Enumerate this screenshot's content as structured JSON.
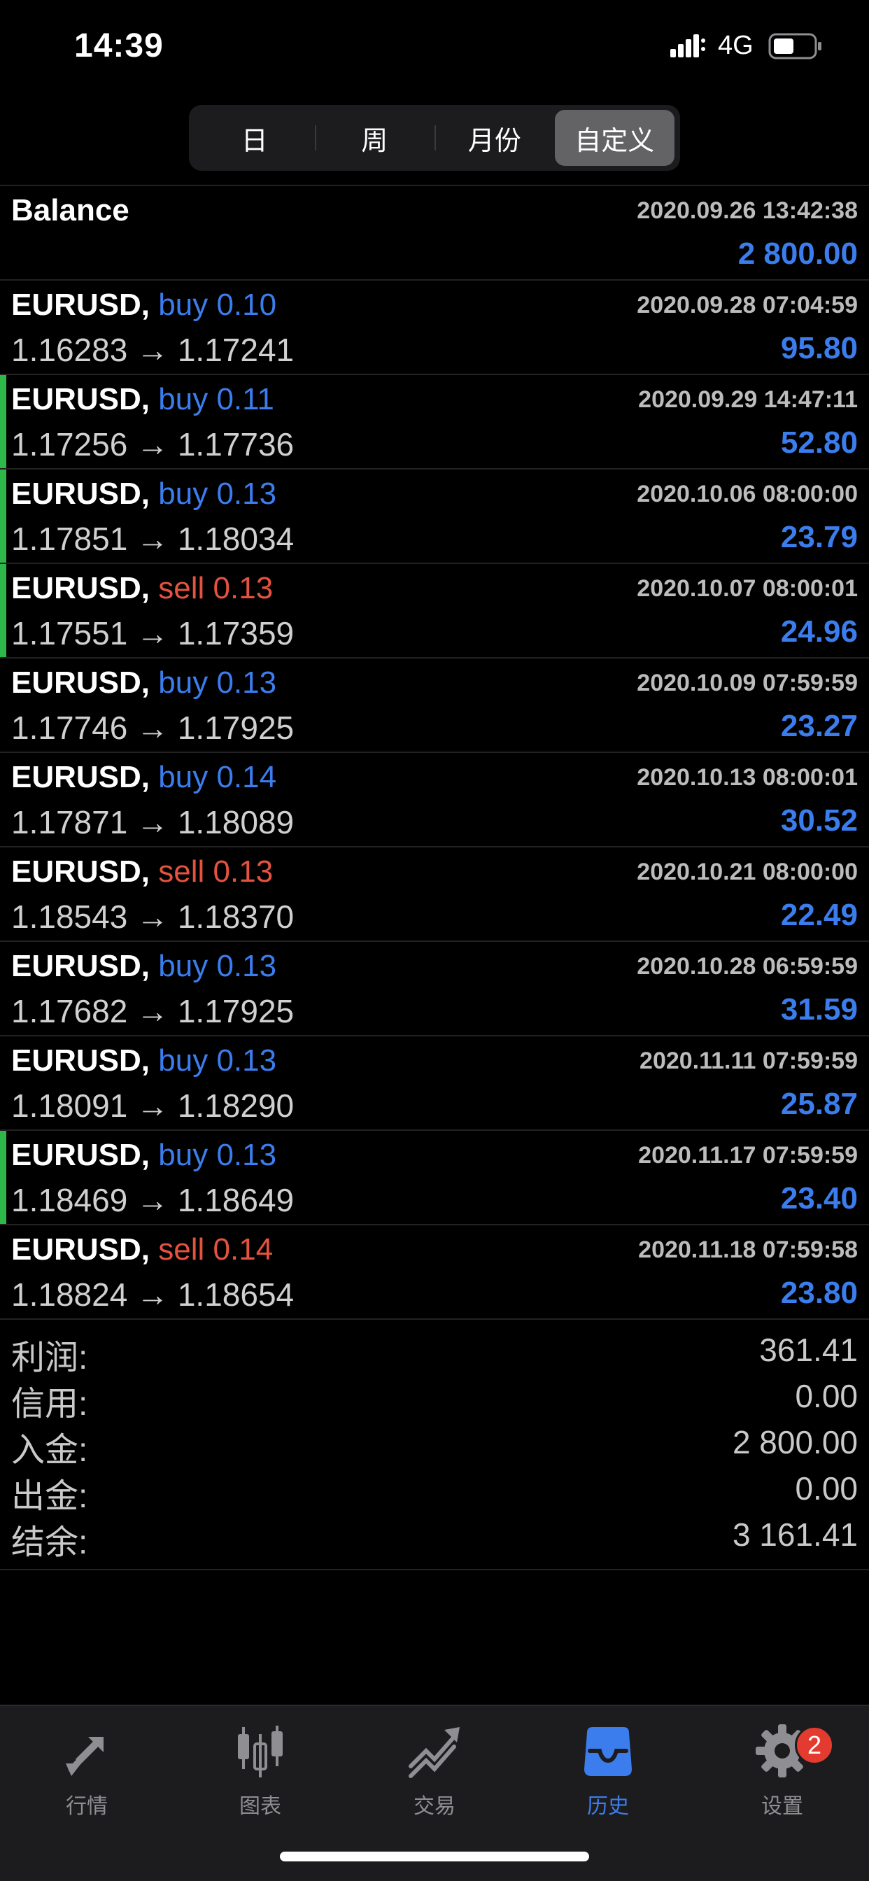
{
  "status_bar": {
    "time": "14:39",
    "network": "4G"
  },
  "period_tabs": [
    {
      "label": "日",
      "active": false
    },
    {
      "label": "周",
      "active": false
    },
    {
      "label": "月份",
      "active": false
    },
    {
      "label": "自定义",
      "active": true
    }
  ],
  "balance_entry": {
    "label": "Balance",
    "date": "2020.09.26 13:42:38",
    "amount": "2 800.00"
  },
  "deals": [
    {
      "symbol": "EURUSD,",
      "type": "buy",
      "volume": "0.10",
      "prices": "1.16283 → 1.17241",
      "date": "2020.09.28 07:04:59",
      "profit": "95.80",
      "marked": false
    },
    {
      "symbol": "EURUSD,",
      "type": "buy",
      "volume": "0.11",
      "prices": "1.17256 → 1.17736",
      "date": "2020.09.29 14:47:11",
      "profit": "52.80",
      "marked": true
    },
    {
      "symbol": "EURUSD,",
      "type": "buy",
      "volume": "0.13",
      "prices": "1.17851 → 1.18034",
      "date": "2020.10.06 08:00:00",
      "profit": "23.79",
      "marked": true
    },
    {
      "symbol": "EURUSD,",
      "type": "sell",
      "volume": "0.13",
      "prices": "1.17551 → 1.17359",
      "date": "2020.10.07 08:00:01",
      "profit": "24.96",
      "marked": true
    },
    {
      "symbol": "EURUSD,",
      "type": "buy",
      "volume": "0.13",
      "prices": "1.17746 → 1.17925",
      "date": "2020.10.09 07:59:59",
      "profit": "23.27",
      "marked": false
    },
    {
      "symbol": "EURUSD,",
      "type": "buy",
      "volume": "0.14",
      "prices": "1.17871 → 1.18089",
      "date": "2020.10.13 08:00:01",
      "profit": "30.52",
      "marked": false
    },
    {
      "symbol": "EURUSD,",
      "type": "sell",
      "volume": "0.13",
      "prices": "1.18543 → 1.18370",
      "date": "2020.10.21 08:00:00",
      "profit": "22.49",
      "marked": false
    },
    {
      "symbol": "EURUSD,",
      "type": "buy",
      "volume": "0.13",
      "prices": "1.17682 → 1.17925",
      "date": "2020.10.28 06:59:59",
      "profit": "31.59",
      "marked": false
    },
    {
      "symbol": "EURUSD,",
      "type": "buy",
      "volume": "0.13",
      "prices": "1.18091 → 1.18290",
      "date": "2020.11.11 07:59:59",
      "profit": "25.87",
      "marked": false
    },
    {
      "symbol": "EURUSD,",
      "type": "buy",
      "volume": "0.13",
      "prices": "1.18469 → 1.18649",
      "date": "2020.11.17 07:59:59",
      "profit": "23.40",
      "marked": true
    },
    {
      "symbol": "EURUSD,",
      "type": "sell",
      "volume": "0.14",
      "prices": "1.18824 → 1.18654",
      "date": "2020.11.18 07:59:58",
      "profit": "23.80",
      "marked": false
    }
  ],
  "summary": [
    {
      "label": "利润:",
      "value": "361.41"
    },
    {
      "label": "信用:",
      "value": "0.00"
    },
    {
      "label": "入金:",
      "value": "2 800.00"
    },
    {
      "label": "出金:",
      "value": "0.00"
    },
    {
      "label": "结余:",
      "value": "3 161.41"
    }
  ],
  "tabbar": {
    "items": [
      {
        "label": "行情",
        "icon": "quotes-arrows-icon",
        "active": false
      },
      {
        "label": "图表",
        "icon": "chart-candles-icon",
        "active": false
      },
      {
        "label": "交易",
        "icon": "trade-trend-icon",
        "active": false
      },
      {
        "label": "历史",
        "icon": "history-inbox-icon",
        "active": true
      },
      {
        "label": "设置",
        "icon": "settings-gear-icon",
        "active": false,
        "badge": "2"
      }
    ]
  },
  "colors": {
    "buy": "#3b7ded",
    "sell": "#e3533f",
    "profit": "#3b7ded",
    "marker": "#2eb84a",
    "active_tab": "#3b7ded"
  }
}
